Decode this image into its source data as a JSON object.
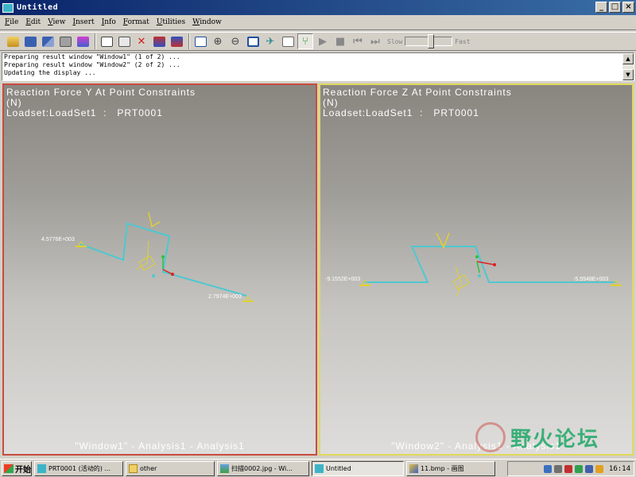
{
  "window": {
    "title": "Untitled",
    "min": "_",
    "max": "□",
    "close": "×"
  },
  "menu": [
    "File",
    "Edit",
    "View",
    "Insert",
    "Info",
    "Format",
    "Utilities",
    "Window"
  ],
  "toolbar": {
    "icons": [
      "open-icon",
      "save-icon",
      "save-copy-icon",
      "print-icon",
      "notebook-icon",
      "edit-icon",
      "copy-icon",
      "delete-icon",
      "insert-window-icon",
      "edit-window-icon",
      "fit-icon",
      "zoom-in-icon",
      "zoom-out-icon",
      "refit-icon",
      "orient-icon",
      "annotate-icon",
      "graph-icon",
      "play-icon",
      "stop-icon",
      "rewind-icon",
      "step-icon"
    ],
    "slow_label": "Slow",
    "fast_label": "Fast",
    "speed": 0.55
  },
  "messages": [
    "Preparing result window \"Window1\" (1 of 2) ...",
    "Preparing result window \"Window2\" (2 of 2) ...",
    "Updating the display ..."
  ],
  "window1": {
    "title": "Reaction Force Y At Point Constraints",
    "unit": "(N)",
    "loadset": "Loadset:LoadSet1  :   PRT0001",
    "footer": "\"Window1\" - Analysis1 - Analysis1",
    "value_a": "4.5776E+003",
    "value_b": "2.7974E+003"
  },
  "window2": {
    "title": "Reaction Force Z At Point Constraints",
    "unit": "(N)",
    "loadset": "Loadset:LoadSet1  :   PRT0001",
    "footer": "\"Window2\" - Analysis1 - Analysis1",
    "value_a": "-9.1552E+003",
    "value_b": "-5.5948E+003"
  },
  "watermark": {
    "text": "野火论坛"
  },
  "taskbar": {
    "start": "开始",
    "tasks": [
      "PRT0001 (活动的) ...",
      "other",
      "扫描0002.jpg - Wi...",
      "Untitled",
      "11.bmp - 画图"
    ],
    "clock": "16:14"
  },
  "colors": {
    "beam": "#4ec8d0",
    "constraint": "#e0d030",
    "axis_x": "#e02020",
    "axis_y": "#30c040",
    "window1_border": "#c84c40",
    "window2_border": "#e0d85c"
  }
}
